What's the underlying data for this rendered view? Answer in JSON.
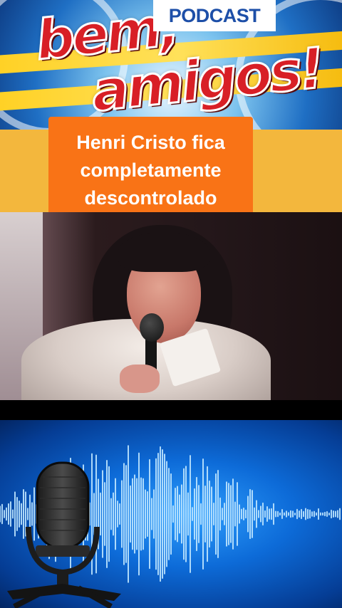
{
  "banner": {
    "badge": "PODCAST",
    "logo_line1": "bem,",
    "logo_line2": "amigos!"
  },
  "headline": {
    "text": "Henri Cristo fica\ncompletamente\ndescontrolado"
  },
  "icons": {
    "microphone": "studio-microphone-icon",
    "waveform": "audio-waveform-icon"
  },
  "colors": {
    "headline_box": "#f97316",
    "strip": "#f3b73d",
    "logo_red": "#d81f26",
    "audio_blue": "#0d6bd8"
  }
}
